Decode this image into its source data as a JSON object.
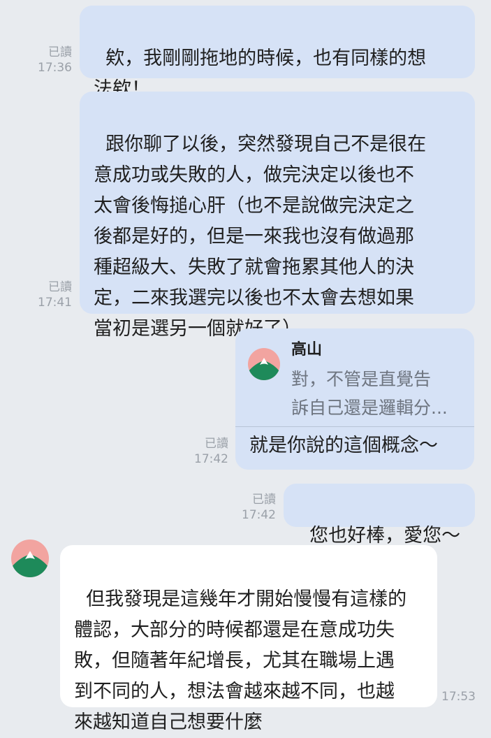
{
  "messages": [
    {
      "text": "欸，我剛剛拖地的時候，也有同樣的想\n法欸！",
      "read": "已讀",
      "time": "17:36"
    },
    {
      "text": "跟你聊了以後，突然發現自己不是很在\n意成功或失敗的人，做完決定以後也不\n太會後悔搥心肝（也不是說做完決定之\n後都是好的，但是一來我也沒有做過那\n種超級大、失敗了就會拖累其他人的決\n定，二來我選完以後也不太會去想如果\n當初是選另一個就好了）",
      "read": "已讀",
      "time": "17:41"
    },
    {
      "reply_name": "高山",
      "reply_quote": "對，不管是直覺告\n訴自己還是邏輯分...",
      "text": "就是你說的這個概念～",
      "read": "已讀",
      "time": "17:42"
    },
    {
      "text": "您也好棒，愛您～",
      "read": "已讀",
      "time": "17:42"
    },
    {
      "text": "但我發現是這幾年才開始慢慢有這樣的\n體認，大部分的時候都還是在意成功失\n敗，但隨著年紀增長，尤其在職場上遇\n到不同的人，想法會越來越不同，也越\n來越知道自己想要什麼",
      "time": "17:53"
    }
  ],
  "colors": {
    "background": "#E8EBEF",
    "outgoing_bubble": "#D6E2F6",
    "incoming_bubble": "#FFFFFF",
    "avatar_bg": "#F2A4A0",
    "avatar_mountain": "#1E8A5A"
  },
  "icons": {
    "avatar": "mountain-avatar-icon"
  }
}
